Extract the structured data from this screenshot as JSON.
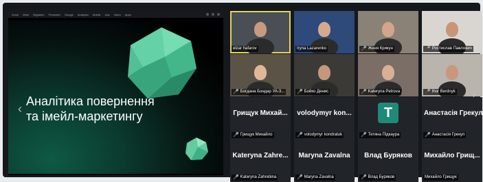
{
  "share": {
    "menu_items": [
      "Zoom",
      "Meet",
      "Migration",
      "Presenter",
      "Google",
      "Analytics",
      "Mobile",
      "Ads",
      "Video",
      "Apps"
    ],
    "slide_title_line1": "Аналітика повернення",
    "slide_title_line2": "та імейл-маркетингу",
    "left_arrow": "‹"
  },
  "participants": [
    {
      "caption": "elzar hafarov",
      "type": "video",
      "muted": false,
      "active": true,
      "bg": "#4a4f55",
      "skin": "#c89a80"
    },
    {
      "caption": "Iryna Lazarenko",
      "type": "video",
      "muted": false,
      "active": false,
      "bg": "#2d4a7a",
      "skin": "#d7a98c"
    },
    {
      "caption": "Женя Крикун",
      "type": "video",
      "muted": true,
      "active": false,
      "bg": "#8a8276",
      "skin": "#d4a58a"
    },
    {
      "caption": "Ростислав Павлович",
      "type": "video",
      "muted": true,
      "active": false,
      "bg": "#d9d6d2",
      "skin": "#c99577"
    },
    {
      "caption": "Богдана Бондар УА-3...",
      "type": "video",
      "muted": true,
      "active": false,
      "bg": "#5c5347",
      "skin": "#e0b899"
    },
    {
      "caption": "Бойко Денис",
      "type": "video",
      "muted": true,
      "active": false,
      "bg": "#3b3a36",
      "skin": "#c4987a"
    },
    {
      "caption": "Kateryna Petrova",
      "type": "video",
      "muted": true,
      "active": false,
      "bg": "#7b6e66",
      "skin": "#d9b096"
    },
    {
      "caption": "Ihor Berdnyk",
      "type": "video",
      "muted": true,
      "active": false,
      "bg": "#b9b4ac",
      "skin": "#c8987d"
    },
    {
      "caption": "Грищук Михайло",
      "big_name": "Грищук Михай...",
      "type": "name",
      "muted": true
    },
    {
      "caption": "volodymyr kondratuk",
      "big_name": "volodymyr kon...",
      "type": "name",
      "muted": true
    },
    {
      "caption": "Тетяна Підкаура",
      "avatar_letter": "T",
      "type": "avatar",
      "muted": true
    },
    {
      "caption": "Анастасія Грекул",
      "big_name": "Анастасія Грекул",
      "type": "name",
      "muted": true
    },
    {
      "caption": "Kateryna Zahrebina",
      "big_name": "Kateryna Zahre...",
      "type": "name",
      "muted": true
    },
    {
      "caption": "Maryna Zavalna",
      "big_name": "Maryna Zavalna",
      "type": "name",
      "muted": true
    },
    {
      "caption": "Влад Буряков",
      "big_name": "Влад Буряков",
      "type": "name",
      "muted": true
    },
    {
      "caption": "Михайло Грищук",
      "big_name": "Михайло Грищ...",
      "type": "name",
      "muted": false
    }
  ],
  "mic_muted_glyph": "🎤",
  "next_page_glyph": "›"
}
